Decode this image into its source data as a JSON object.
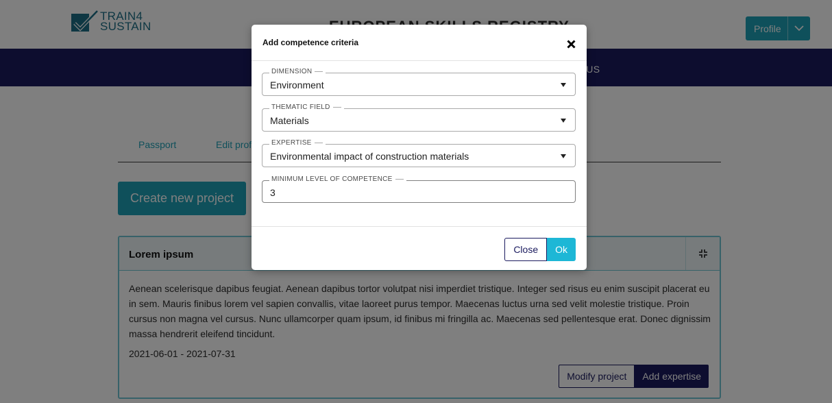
{
  "brand": {
    "logo_text_line1": "TRAIN4",
    "logo_text_line2": "SUSTAIN",
    "site_title": "EUROPEAN SKILLS REGISTRY"
  },
  "header": {
    "profile_label": "Profile"
  },
  "nav": {
    "visible_item": "T US"
  },
  "tabs": [
    {
      "label": "Passport"
    },
    {
      "label": "Edit prof"
    }
  ],
  "page": {
    "create_project_label": "Create new project"
  },
  "project_card": {
    "title": "Lorem ipsum",
    "description": "Aenean scelerisque dapibus feugiat. Aenean dapibus tortor volutpat nisi imperdiet tristique. Integer sed risus eu enim suscipit placerat eu in sem. Mauris finibus lorem vel sapien convallis, vitae laoreet purus tempor. Maecenas luctus urna sed velit molestie tristique. Proin cursus non magna vel cursus. Nunc ullamcorper quam ipsum, id finibus mi fringilla ac. Maecenas sed pellentesque erat. Donec dignissim massa hendrerit eleifend tincidunt.",
    "dates": "2021-06-01 - 2021-07-31",
    "modify_label": "Modify project",
    "add_expertise_label": "Add expertise"
  },
  "modal": {
    "title": "Add competence criteria",
    "fields": {
      "dimension": {
        "label": "DIMENSION",
        "value": "Environment"
      },
      "thematic_field": {
        "label": "THEMATIC FIELD",
        "value": "Materials"
      },
      "expertise": {
        "label": "EXPERTISE",
        "value": "Environmental impact of construction materials"
      },
      "min_level": {
        "label": "MINIMUM LEVEL OF COMPETENCE",
        "value": "3"
      }
    },
    "close_label": "Close",
    "ok_label": "Ok"
  },
  "colors": {
    "accent": "#1ea0b6",
    "navy": "#1a1a5e",
    "ok": "#1db7d6",
    "card_border": "#6ec4d2"
  },
  "icons": {
    "close": "close-icon",
    "caret": "caret-down-icon",
    "collapse": "collapse-icon",
    "chevron": "chevron-down-icon",
    "logo": "checkmark-logo"
  }
}
